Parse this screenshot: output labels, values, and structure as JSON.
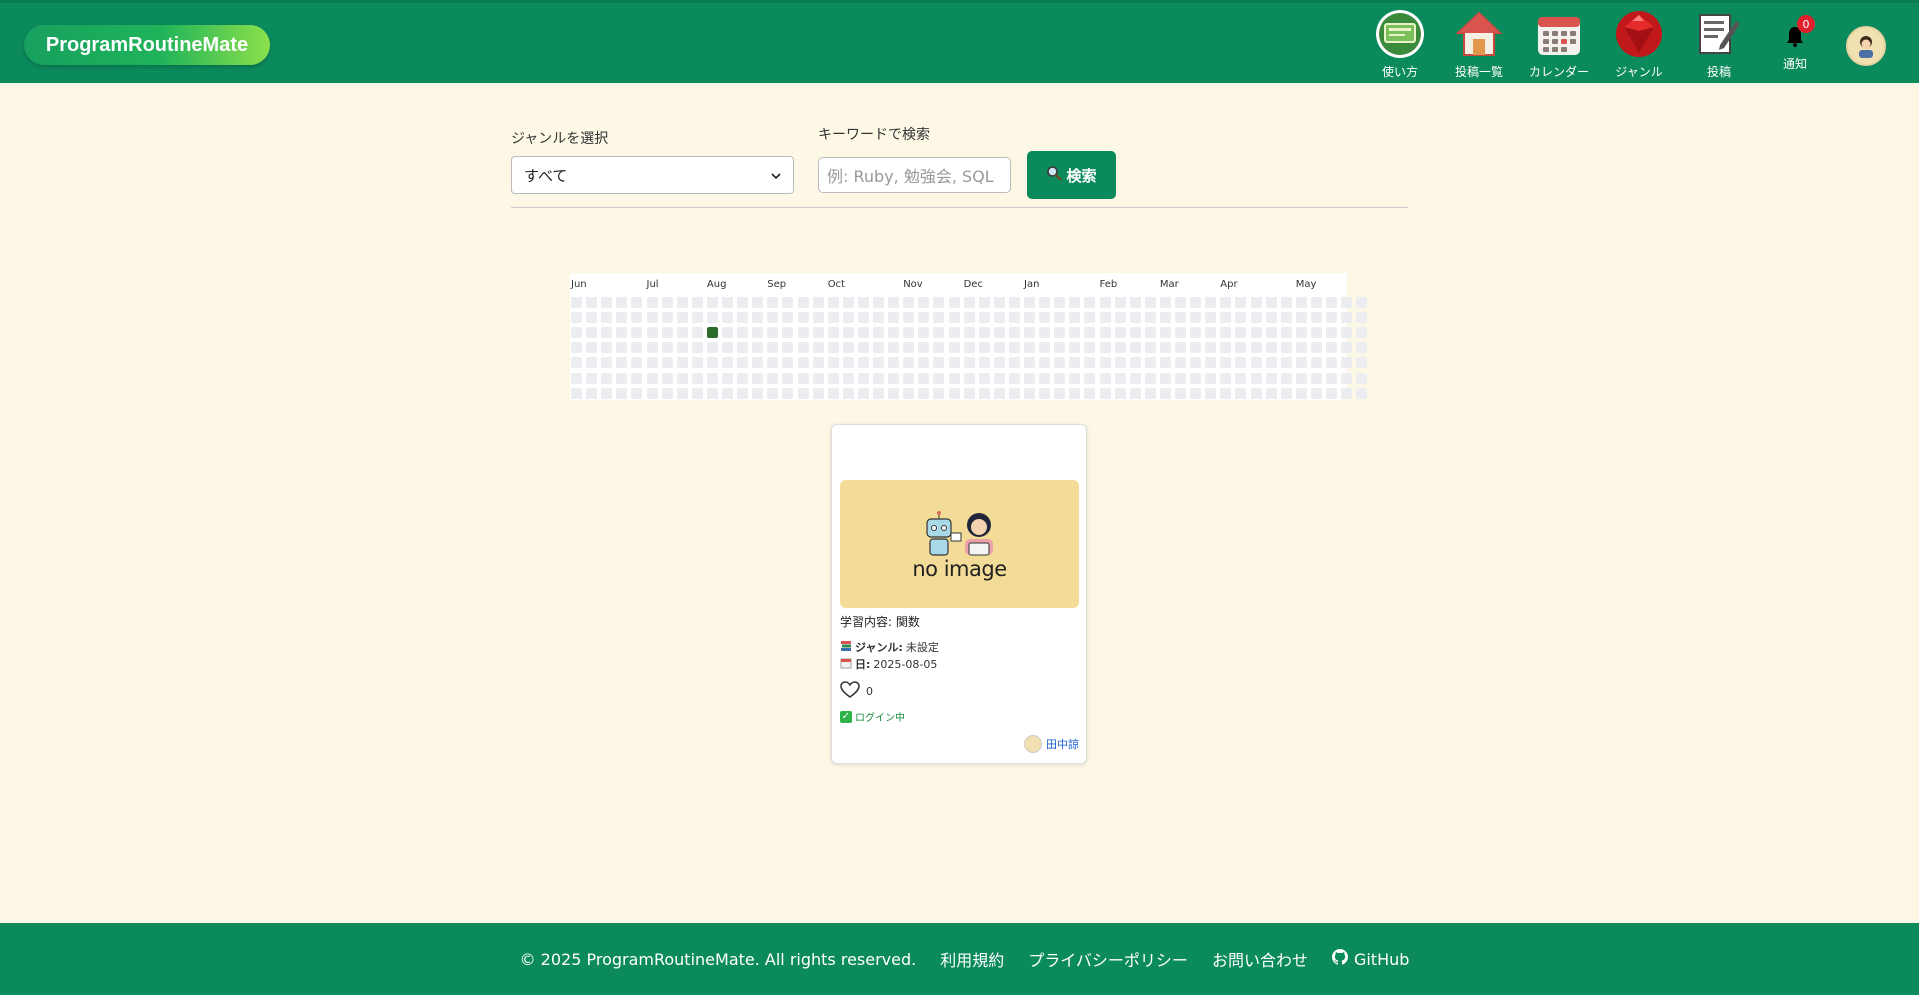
{
  "header": {
    "logo": "ProgramRoutineMate",
    "nav": [
      {
        "label": "使い方",
        "icon": "manual-icon"
      },
      {
        "label": "投稿一覧",
        "icon": "home-icon"
      },
      {
        "label": "カレンダー",
        "icon": "calendar-icon"
      },
      {
        "label": "ジャンル",
        "icon": "ruby-gem-icon"
      },
      {
        "label": "投稿",
        "icon": "post-edit-icon"
      },
      {
        "label": "通知",
        "icon": "bell-icon"
      }
    ],
    "notification_count": "0"
  },
  "search": {
    "genre_label": "ジャンルを選択",
    "genre_selected": "すべて",
    "keyword_label": "キーワードで検索",
    "keyword_placeholder": "例: Ruby, 勉強会, SQL",
    "button_label": "検索"
  },
  "heatmap": {
    "months": [
      "Jun",
      "Jul",
      "Aug",
      "Sep",
      "Oct",
      "Nov",
      "Dec",
      "Jan",
      "Feb",
      "Mar",
      "Apr",
      "May"
    ],
    "active_color": "#2d6a2d",
    "empty_color": "#ebedf0",
    "active_cells": [
      {
        "week": 9,
        "day": 2
      }
    ]
  },
  "card": {
    "image_text": "no image",
    "title": "学習内容: 関数",
    "genre_key": "ジャンル:",
    "genre_value": "未設定",
    "date_key": "日:",
    "date_value": "2025-08-05",
    "likes": "0",
    "login_status": "ログイン中",
    "author": "田中諒"
  },
  "footer": {
    "copyright": "© 2025 ProgramRoutineMate. All rights reserved.",
    "links": [
      "利用規約",
      "プライバシーポリシー",
      "お問い合わせ",
      "GitHub"
    ]
  },
  "colors": {
    "brand_green": "#0b8a5c",
    "page_bg": "#fdf8e6"
  }
}
